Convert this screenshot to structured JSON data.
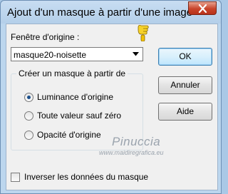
{
  "window": {
    "title": "Ajout d'un masque à partir d'une image"
  },
  "source": {
    "label": "Fenêtre d'origine :",
    "selected": "masque20-noisette"
  },
  "group": {
    "title": "Créer un masque à partir de",
    "options": [
      {
        "label": "Luminance d'origine",
        "checked": true
      },
      {
        "label": "Toute valeur sauf zéro",
        "checked": false
      },
      {
        "label": "Opacité d'origine",
        "checked": false
      }
    ]
  },
  "buttons": {
    "ok": "OK",
    "cancel": "Annuler",
    "help": "Aide"
  },
  "invert": {
    "label": "Inverser les données du masque",
    "checked": false
  },
  "watermark": {
    "name": "Pinuccia",
    "url": "www.maidiregrafica.eu"
  }
}
